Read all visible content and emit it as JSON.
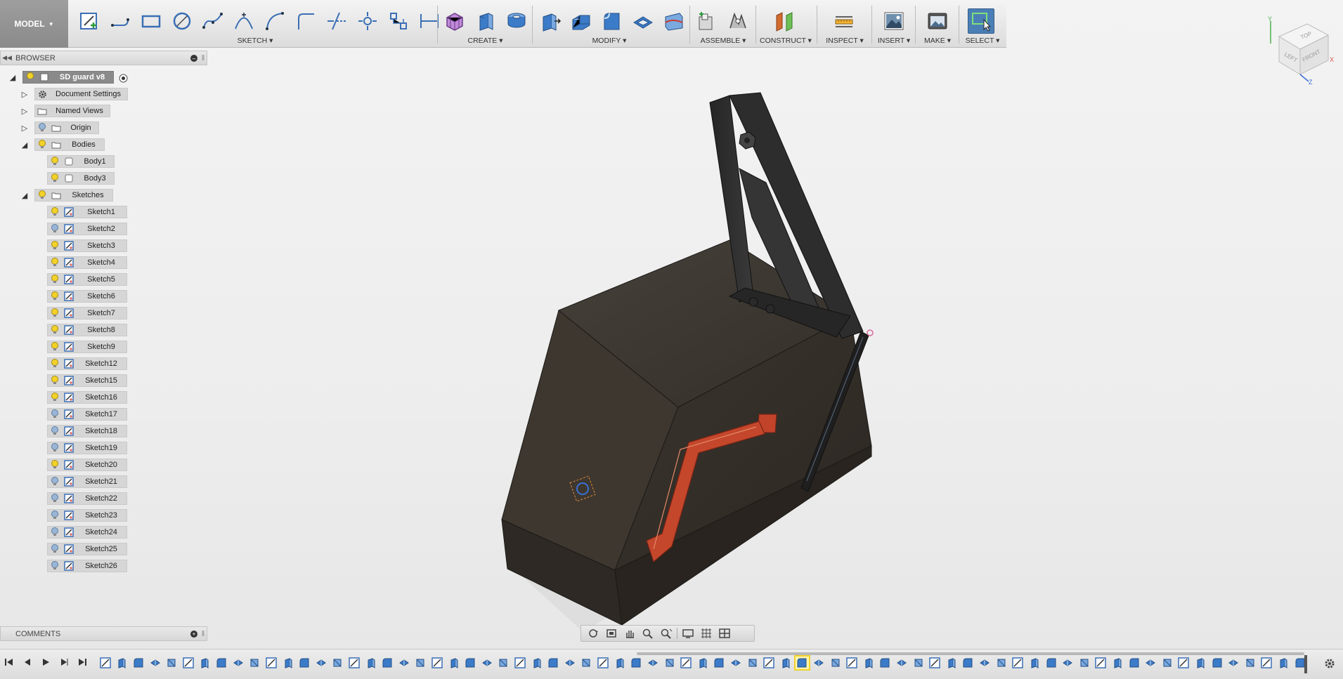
{
  "toolbar": {
    "workspace": "MODEL",
    "groups": {
      "sketch": "SKETCH",
      "create": "CREATE",
      "modify": "MODIFY",
      "assemble": "ASSEMBLE",
      "construct": "CONSTRUCT",
      "inspect": "INSPECT",
      "insert": "INSERT",
      "make": "MAKE",
      "select": "SELECT"
    }
  },
  "viewcube": {
    "top": "TOP",
    "left": "LEFT",
    "front": "FRONT",
    "axis_x": "X",
    "axis_y": "Y",
    "axis_z": "Z"
  },
  "browser": {
    "title": "BROWSER",
    "root": "SD guard v8",
    "document_settings": "Document Settings",
    "named_views": "Named Views",
    "origin": "Origin",
    "bodies": {
      "label": "Bodies",
      "items": [
        "Body1",
        "Body3"
      ]
    },
    "sketches": {
      "label": "Sketches",
      "items": [
        "Sketch1",
        "Sketch2",
        "Sketch3",
        "Sketch4",
        "Sketch5",
        "Sketch6",
        "Sketch7",
        "Sketch8",
        "Sketch9",
        "Sketch12",
        "Sketch15",
        "Sketch16",
        "Sketch17",
        "Sketch18",
        "Sketch19",
        "Sketch20",
        "Sketch21",
        "Sketch22",
        "Sketch23",
        "Sketch24",
        "Sketch25",
        "Sketch26"
      ]
    }
  },
  "comments": {
    "title": "COMMENTS"
  },
  "colors": {
    "accent": "#4a7fb5",
    "body_dark": "#3a342c",
    "handle_red": "#c0432a",
    "bulb_on": "#f2d22a",
    "bulb_off": "#9ab6d6"
  }
}
